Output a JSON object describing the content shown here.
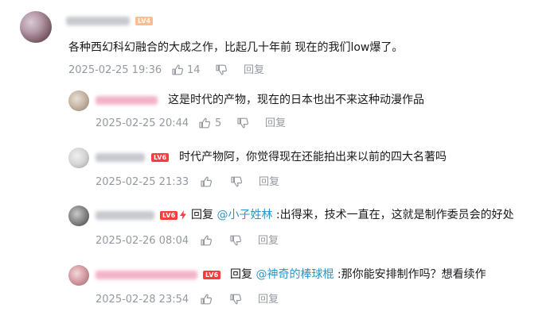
{
  "main_comment": {
    "level_badge": "LV4",
    "text": "各种西幻科幻融合的大成之作，比起几十年前 现在的我们low爆了。",
    "timestamp": "2025-02-25 19:36",
    "likes": "14",
    "reply_label": "回复"
  },
  "replies": [
    {
      "text": "这是时代的产物，现在的日本也出不来这种动漫作品",
      "timestamp": "2025-02-25 20:44",
      "likes": "5",
      "reply_label": "回复"
    },
    {
      "level_badge": "LV6",
      "text": "时代产物阿，你觉得现在还能拍出来以前的四大名著吗",
      "timestamp": "2025-02-25 21:33",
      "reply_label": "回复"
    },
    {
      "level_badge": "LV6",
      "reply_prefix": "回复 ",
      "mention": "@小子姓林",
      "text": " :出得来，技术一直在，这就是制作委员会的好处",
      "timestamp": "2025-02-26 08:04",
      "reply_label": "回复"
    },
    {
      "level_badge": "LV6",
      "reply_prefix": "回复 ",
      "mention": "@神奇的棒球棍",
      "text": " :那你能安排制作吗？想看续作",
      "timestamp": "2025-02-28 23:54",
      "reply_label": "回复"
    }
  ],
  "icons": {
    "like": "thumb-up-icon",
    "dislike": "thumb-down-icon",
    "vip": "lightning-bolt-icon"
  },
  "colors": {
    "mention": "#2f93c4",
    "meta": "#9499a0",
    "level6": "#ff3b3b",
    "level4": "#ffb27a",
    "vip_name": "#f3b3c8"
  }
}
